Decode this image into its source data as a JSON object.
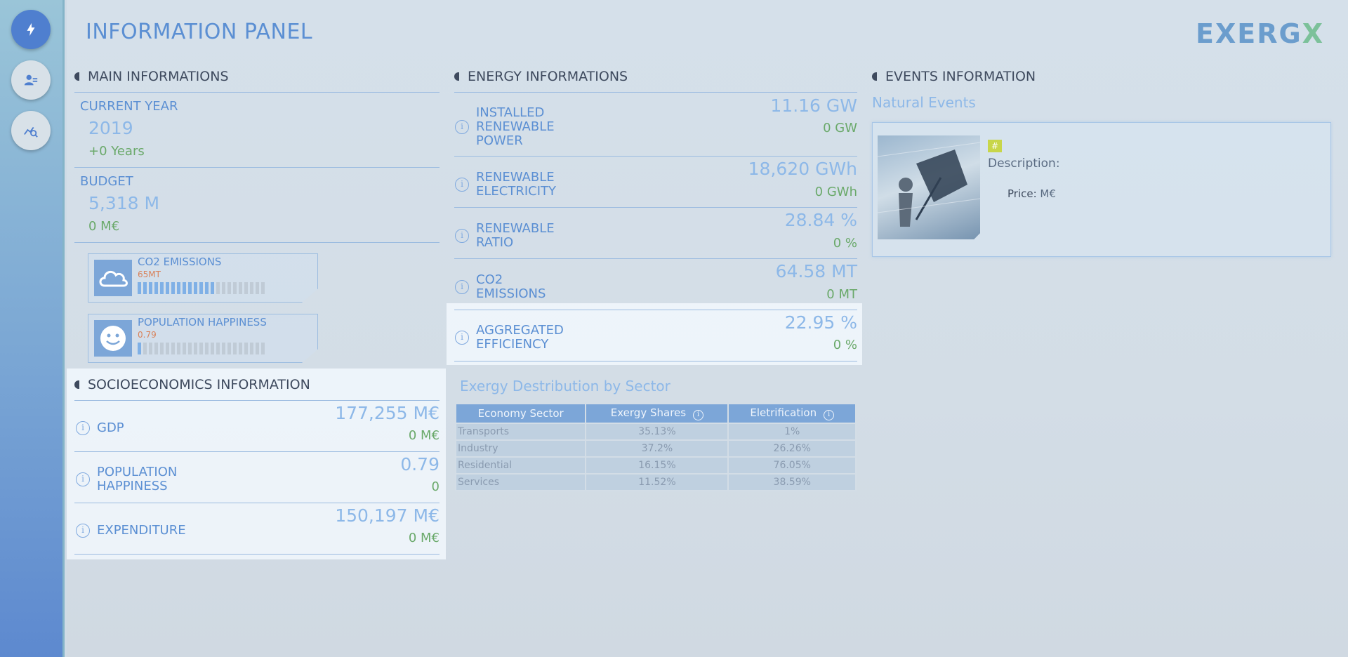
{
  "page_title": "INFORMATION PANEL",
  "logo": {
    "main": "EXERG",
    "accent": "X"
  },
  "main_info": {
    "title": "MAIN INFORMATIONS",
    "current_year": {
      "label": "CURRENT YEAR",
      "value": "2019",
      "delta": "+0 Years"
    },
    "budget": {
      "label": "BUDGET",
      "value": "5,318 M",
      "delta": "0 M€"
    },
    "gauges": [
      {
        "title": "CO2 EMISSIONS",
        "value": "65MT",
        "icon": "cloud-icon",
        "level": 0.6
      },
      {
        "title": "POPULATION HAPPINESS",
        "value": "0.79",
        "icon": "smiley-icon",
        "level": 0.05
      }
    ]
  },
  "socio": {
    "title": "SOCIOECONOMICS INFORMATION",
    "rows": [
      {
        "label": "GDP",
        "value": "177,255 M€",
        "delta": "0 M€"
      },
      {
        "label": "POPULATION HAPPINESS",
        "value": "0.79",
        "delta": "0"
      },
      {
        "label": "EXPENDITURE",
        "value": "150,197 M€",
        "delta": "0 M€"
      }
    ]
  },
  "energy": {
    "title": "ENERGY INFORMATIONS",
    "rows": [
      {
        "label": "INSTALLED RENEWABLE POWER",
        "value": "11.16 GW",
        "delta": "0 GW"
      },
      {
        "label": "RENEWABLE ELECTRICITY",
        "value": "18,620 GWh",
        "delta": "0 GWh"
      },
      {
        "label": "RENEWABLE RATIO",
        "value": "28.84 %",
        "delta": "0 %"
      },
      {
        "label": "CO2 EMISSIONS",
        "value": "64.58 MT",
        "delta": "0 MT"
      },
      {
        "label": "AGGREGATED EFFICIENCY",
        "value": "22.95 %",
        "delta": "0 %"
      }
    ]
  },
  "exergy": {
    "title": "Exergy Destribution by Sector",
    "headers": [
      "Economy Sector",
      "Exergy Shares",
      "Eletrification"
    ],
    "rows": [
      [
        "Transports",
        "35.13%",
        "1%"
      ],
      [
        "Industry",
        "37.2%",
        "26.26%"
      ],
      [
        "Residential",
        "16.15%",
        "76.05%"
      ],
      [
        "Services",
        "11.52%",
        "38.59%"
      ]
    ]
  },
  "events": {
    "title": "EVENTS INFORMATION",
    "subtitle": "Natural Events",
    "card": {
      "tag": "#",
      "description": "Description:",
      "price_label": "Price:",
      "price_value": " M€"
    }
  }
}
